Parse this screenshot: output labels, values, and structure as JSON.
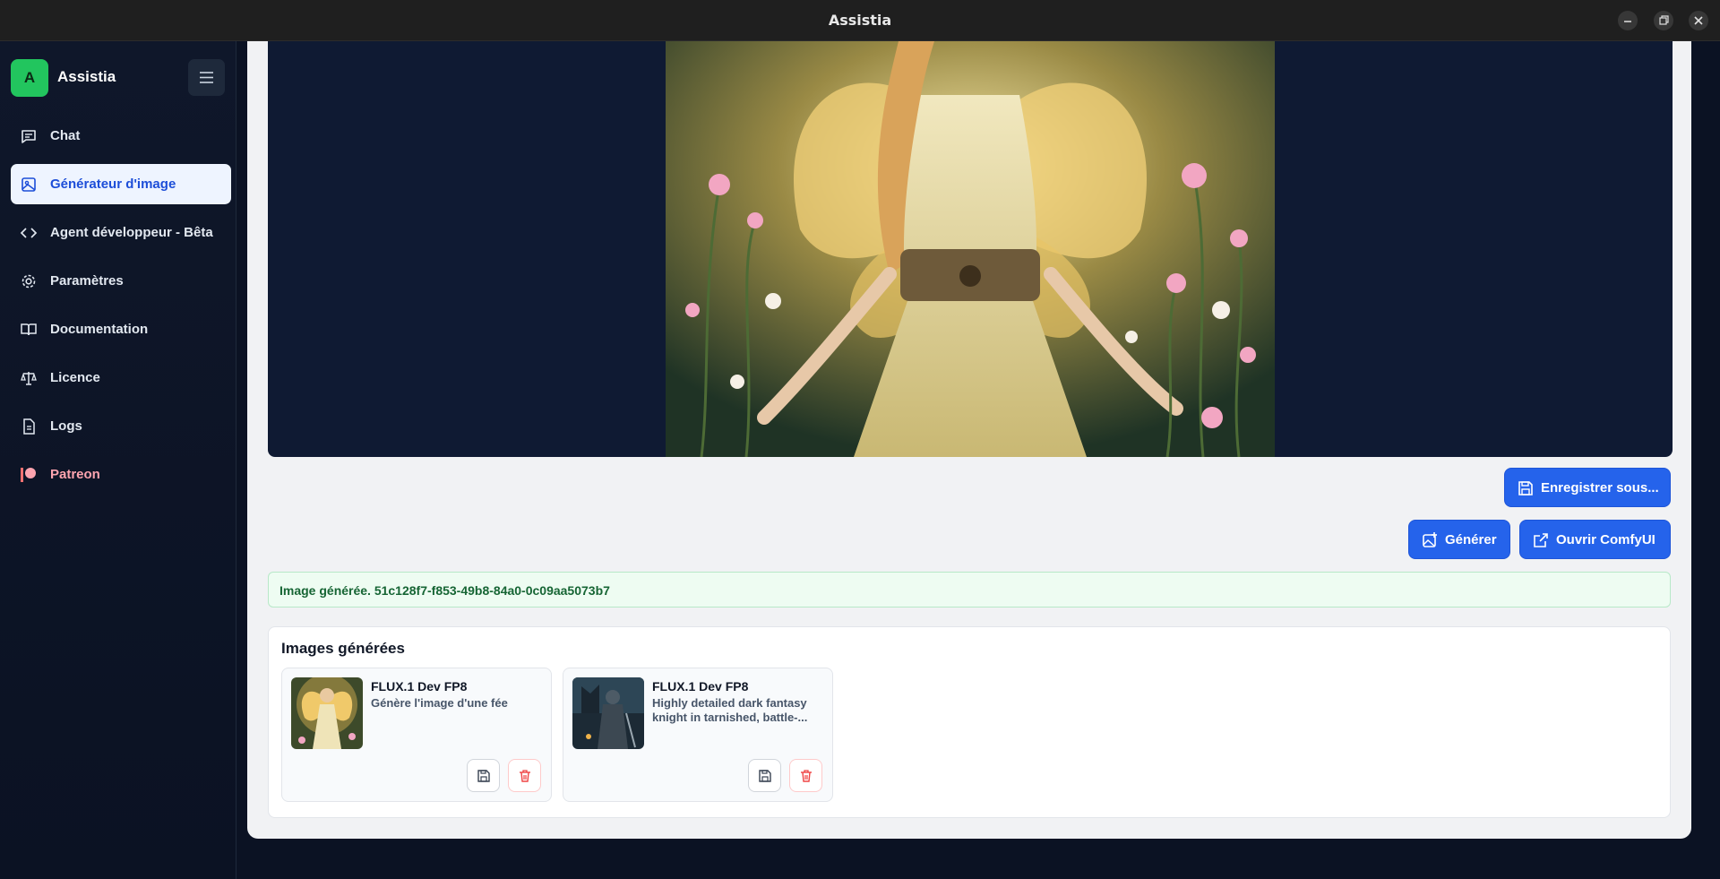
{
  "window": {
    "title": "Assistia"
  },
  "sidebar": {
    "brand_initial": "A",
    "brand_name": "Assistia",
    "items": [
      {
        "label": "Chat",
        "icon": "chat-icon",
        "active": false
      },
      {
        "label": "Générateur d'image",
        "icon": "image-icon",
        "active": true
      },
      {
        "label": "Agent développeur - Bêta",
        "icon": "code-icon",
        "active": false
      },
      {
        "label": "Paramètres",
        "icon": "gear-icon",
        "active": false
      },
      {
        "label": "Documentation",
        "icon": "book-icon",
        "active": false
      },
      {
        "label": "Licence",
        "icon": "scale-icon",
        "active": false
      },
      {
        "label": "Logs",
        "icon": "file-icon",
        "active": false
      },
      {
        "label": "Patreon",
        "icon": "patreon-icon",
        "active": false
      }
    ]
  },
  "actions": {
    "save_as": "Enregistrer sous...",
    "generate": "Générer",
    "open_comfy": "Ouvrir ComfyUI"
  },
  "status": {
    "message": "Image générée. 51c128f7-f853-49b8-84a0-0c09aa5073b7"
  },
  "gallery": {
    "title": "Images générées",
    "items": [
      {
        "model": "FLUX.1 Dev FP8",
        "description": "Génère l'image d'une fée"
      },
      {
        "model": "FLUX.1 Dev FP8",
        "description": "Highly detailed dark fantasy knight in tarnished, battle-..."
      }
    ]
  },
  "colors": {
    "accent": "#2563eb",
    "success": "#166534",
    "danger": "#ef4444",
    "brand": "#22c55e"
  }
}
